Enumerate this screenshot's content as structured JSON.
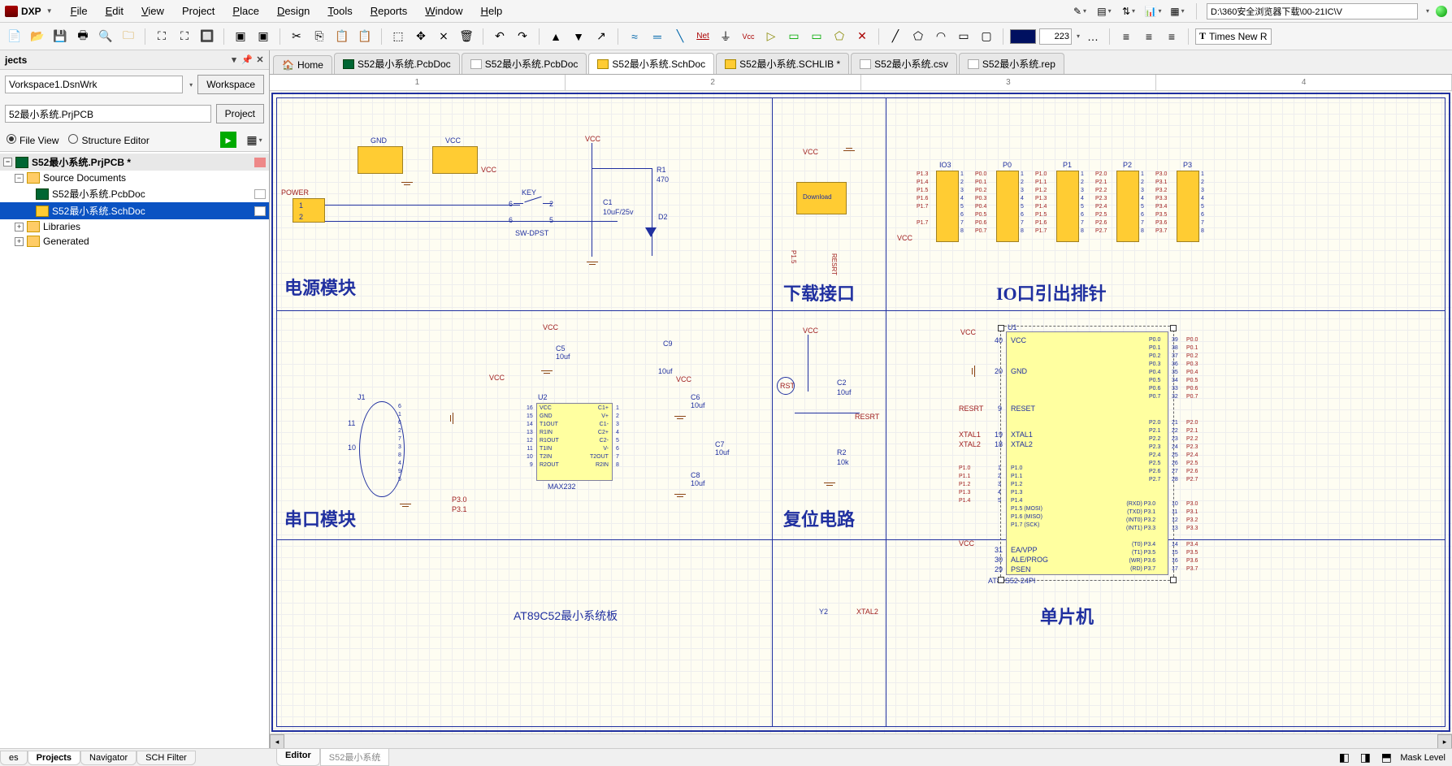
{
  "menu": {
    "dxp": "DXP",
    "items": [
      "File",
      "Edit",
      "View",
      "Project",
      "Place",
      "Design",
      "Tools",
      "Reports",
      "Window",
      "Help"
    ],
    "path": "D:\\360安全浏览器下载\\00-21IC\\V"
  },
  "toolbar": {
    "color_value": "223",
    "font_label": "Times New R"
  },
  "panel": {
    "title": "jects",
    "workspace_value": "Vorkspace1.DsnWrk",
    "workspace_btn": "Workspace",
    "project_value": "52最小系统.PrjPCB",
    "project_btn": "Project",
    "fileview": "File View",
    "structview": "Structure Editor"
  },
  "tree": {
    "project": "S52最小系统.PrjPCB *",
    "source_docs": "Source Documents",
    "pcb": "S52最小系统.PcbDoc",
    "sch": "S52最小系统.SchDoc",
    "libraries": "Libraries",
    "generated": "Generated"
  },
  "tabs": {
    "home": "Home",
    "pcb1": "S52最小系统.PcbDoc",
    "pcb2": "S52最小系统.PcbDoc",
    "sch": "S52最小系统.SchDoc",
    "schlib": "S52最小系统.SCHLIB *",
    "csv": "S52最小系统.csv",
    "rep": "S52最小系统.rep"
  },
  "ruler": {
    "n1": "1",
    "n2": "2",
    "n3": "3",
    "n4": "4"
  },
  "schematic": {
    "block1_title": "电源模块",
    "block2_title": "下载接口",
    "block3_title": "IO口引出排针",
    "block4_title": "串口模块",
    "block5_title": "复位电路",
    "block6_title": "单片机",
    "power_label": "POWER",
    "gnd": "GND",
    "vcc": "VCC",
    "key": "KEY",
    "sw": "SW-DPST",
    "r1": "R1",
    "r1v": "470",
    "c1": "C1",
    "c1v": "10uF/25v",
    "d2": "D2",
    "download": "Download",
    "resrt": "RESRT",
    "j1": "J1",
    "u2": "U2",
    "max232": "MAX232",
    "c5": "C5",
    "c5v": "10uf",
    "c9": "C9",
    "c9v": "10uf",
    "c6": "C6",
    "c6v": "10uf",
    "c7": "C7",
    "c7v": "10uf",
    "c8": "C8",
    "c8v": "10uf",
    "p30": "P3.0",
    "p31": "P3.1",
    "rst": "RST",
    "c2": "C2",
    "c2v": "10uf",
    "r2": "R2",
    "r2v": "10k",
    "xtal1": "XTAL1",
    "xtal2": "XTAL2",
    "u1": "U1",
    "mcu": "AT89S52-24PI",
    "reset": "RESET",
    "eavpp": "EA/VPP",
    "aleprog": "ALE/PROG",
    "psen": "PSEN",
    "io_headers": [
      "IO3",
      "P0",
      "P1",
      "P2",
      "P3"
    ],
    "bottom_title": "AT89C52最小系统板",
    "y2": "Y2"
  },
  "bottom_tabs": {
    "es": "es",
    "projects": "Projects",
    "navigator": "Navigator",
    "schfilter": "SCH Filter"
  },
  "sub_tabs": {
    "editor": "Editor",
    "file": "S52最小系统"
  },
  "status": {
    "mask": "Mask Level"
  }
}
